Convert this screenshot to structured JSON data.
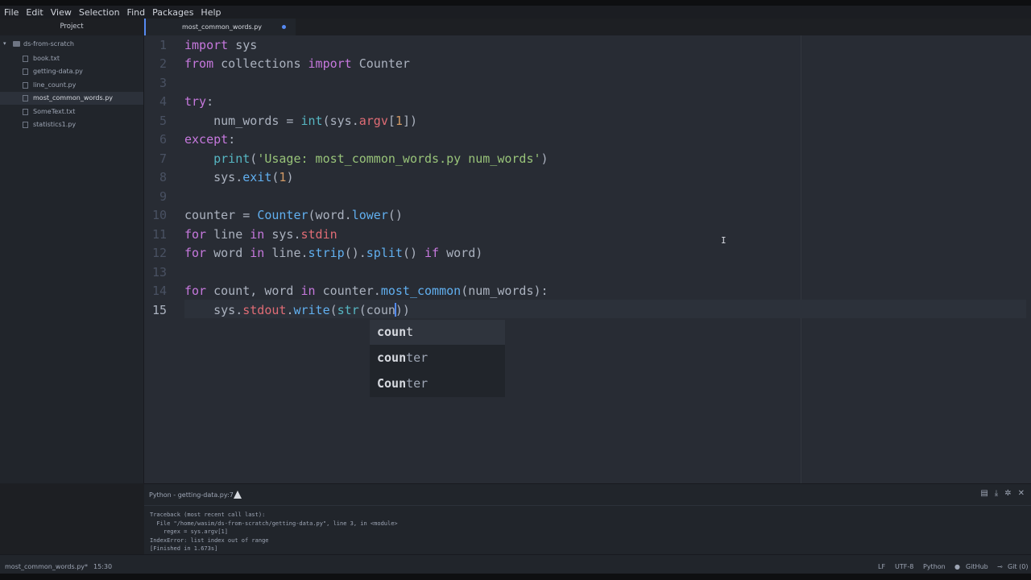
{
  "menu": [
    "File",
    "Edit",
    "View",
    "Selection",
    "Find",
    "Packages",
    "Help"
  ],
  "sidebar": {
    "title": "Project",
    "root": "ds-from-scratch",
    "files": [
      "book.txt",
      "getting-data.py",
      "line_count.py",
      "most_common_words.py",
      "SomeText.txt",
      "statistics1.py"
    ],
    "selected_index": 3
  },
  "tab": {
    "title": "most_common_words.py",
    "modified": true
  },
  "editor": {
    "line_numbers": [
      "1",
      "2",
      "3",
      "4",
      "5",
      "6",
      "7",
      "8",
      "9",
      "10",
      "11",
      "12",
      "13",
      "14",
      "15"
    ],
    "lines": [
      "import sys",
      "from collections import Counter",
      "",
      "try:",
      "    num_words = int(sys.argv[1])",
      "except:",
      "    print('Usage: most_common_words.py num_words')",
      "    sys.exit(1)",
      "",
      "counter = Counter(word.lower()",
      "for line in sys.stdin",
      "for word in line.strip().split() if word)",
      "",
      "for count, word in counter.most_common(num_words):",
      "    sys.stdout.write(str(coun))"
    ],
    "cursor": "15:30"
  },
  "autocomplete": {
    "typed": "coun",
    "items": [
      "count",
      "counter",
      "Counter"
    ],
    "selected_index": 0
  },
  "panel": {
    "title": "Python - getting-data.py:7",
    "output": [
      "Traceback (most recent call last):",
      "  File \"/home/wasim/ds-from-scratch/getting-data.py\", line 3, in <module>",
      "    regex = sys.argv[1]",
      "IndexError: list index out of range",
      "[Finished in 1.673s]"
    ]
  },
  "status": {
    "file": "most_common_words.py*",
    "position": "15:30",
    "line_ending": "LF",
    "encoding": "UTF-8",
    "grammar": "Python",
    "github": "GitHub",
    "git": "Git (0)"
  }
}
